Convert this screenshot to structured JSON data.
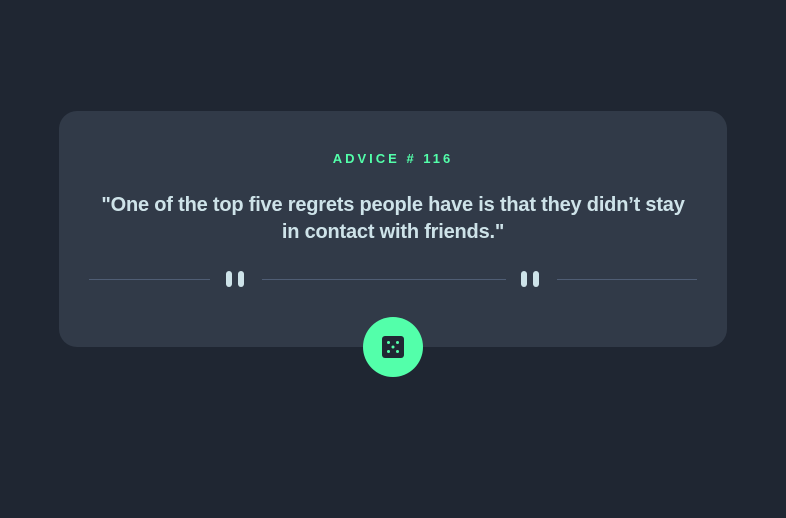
{
  "advice": {
    "label": "ADVICE # 116",
    "quote": "\"One of the top five regrets people have is that they didn’t stay in contact with friends.\""
  },
  "divider": {
    "icon": "pause-icon"
  },
  "button": {
    "icon": "dice-icon"
  },
  "colors": {
    "background": "#1f2632",
    "card": "#313a48",
    "accent": "#53ffaa",
    "text": "#cee3e9",
    "divider": "#4f5d74"
  }
}
